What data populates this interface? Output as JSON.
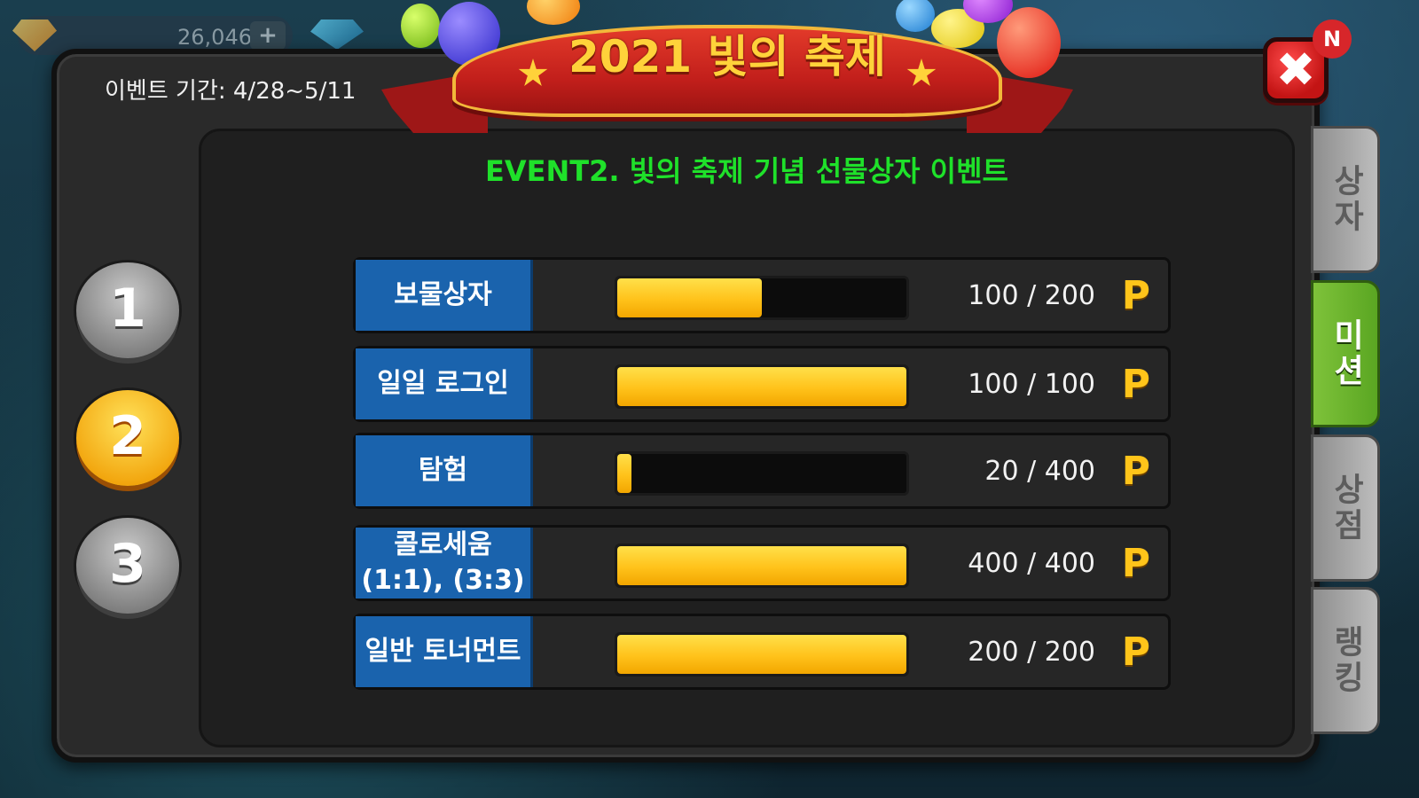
{
  "hud": {
    "currency_value": "26,046",
    "currency_add": "+"
  },
  "header": {
    "event_period": "이벤트 기간: 4/28~5/11",
    "ribbon_title": "2021 빛의 축제",
    "subtitle": "EVENT2. 빛의 축제 기념 선물상자 이벤트",
    "close_label": "✖",
    "notification_badge": "N"
  },
  "steps": [
    {
      "label": "1",
      "active": false
    },
    {
      "label": "2",
      "active": true
    },
    {
      "label": "3",
      "active": false
    }
  ],
  "missions": [
    {
      "name": "보물상자",
      "current": 100,
      "max": 200,
      "progress_text": "100 / 200",
      "unit": "P"
    },
    {
      "name": "일일 로그인",
      "current": 100,
      "max": 100,
      "progress_text": "100 / 100",
      "unit": "P"
    },
    {
      "name": "탐험",
      "current": 20,
      "max": 400,
      "progress_text": "20 / 400",
      "unit": "P"
    },
    {
      "name": "콜로세움\n(1:1), (3:3)",
      "current": 400,
      "max": 400,
      "progress_text": "400 / 400",
      "unit": "P"
    },
    {
      "name": "일반 토너먼트",
      "current": 200,
      "max": 200,
      "progress_text": "200 / 200",
      "unit": "P"
    }
  ],
  "side_tabs": [
    {
      "label": "상자",
      "active": false
    },
    {
      "label": "미션",
      "active": true
    },
    {
      "label": "상점",
      "active": false
    },
    {
      "label": "랭킹",
      "active": false
    }
  ],
  "colors": {
    "accent_gold": "#ffc21a",
    "label_blue": "#1a63ad",
    "subtitle_green": "#1fe12a",
    "ribbon_red": "#c21f1b"
  }
}
